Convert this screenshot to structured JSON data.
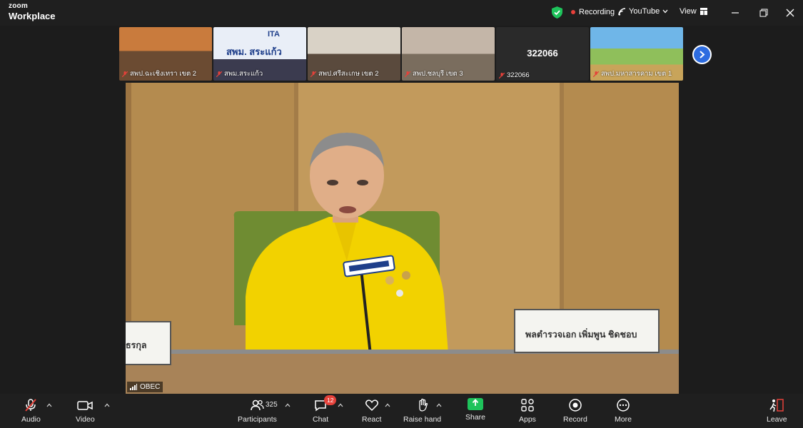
{
  "app": {
    "logo_line1": "zoom",
    "logo_line2": "Workplace"
  },
  "titlebar": {
    "recording": "Recording",
    "stream": "YouTube",
    "view": "View",
    "accent_green": "#1ec35b",
    "record_red": "#e8403a"
  },
  "thumbnails": [
    {
      "label": "สพป.ฉะเชิงเทรา เขต 2"
    },
    {
      "label": "สพม.สระแก้ว",
      "screen_text": "สพม. สระแก้ว",
      "logo_text": "ITA"
    },
    {
      "label": "สพป.ศรีสะเกษ เขต 2"
    },
    {
      "label": "สพป.ชลบุรี เขต 3"
    },
    {
      "label": "322066",
      "screen_text": "322066"
    },
    {
      "label": "สพป.มหาสารคาม เขต 1"
    }
  ],
  "video": {
    "label": "OBEC",
    "nameplate": "พลตำรวจเอก เพิ่มพูน ชิดชอบ",
    "left_plate": "ธรกุล"
  },
  "toolbar": {
    "audio": "Audio",
    "video": "Video",
    "participants": "Participants",
    "participants_count": "325",
    "chat": "Chat",
    "chat_badge": "12",
    "react": "React",
    "raise_hand": "Raise hand",
    "share": "Share",
    "apps": "Apps",
    "record": "Record",
    "more": "More",
    "leave": "Leave"
  }
}
